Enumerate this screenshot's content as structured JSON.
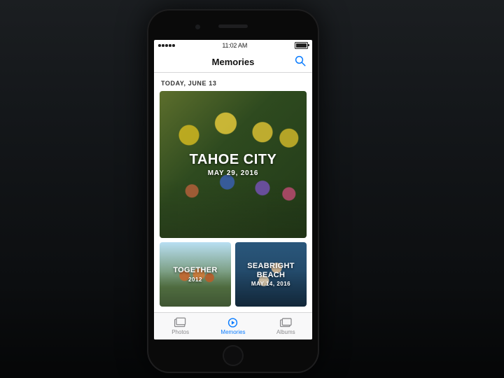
{
  "status": {
    "time": "11:02 AM"
  },
  "nav": {
    "title": "Memories"
  },
  "section_header": "TODAY, JUNE 13",
  "cards": {
    "large": {
      "title": "TAHOE CITY",
      "subtitle": "MAY 29, 2016"
    },
    "smallA": {
      "title": "TOGETHER",
      "subtitle": "2012"
    },
    "smallB": {
      "title": "SEABRIGHT BEACH",
      "subtitle": "MAY 14, 2016"
    }
  },
  "tabs": {
    "photos": "Photos",
    "memories": "Memories",
    "albums": "Albums"
  },
  "colors": {
    "accent": "#0a7cff"
  }
}
